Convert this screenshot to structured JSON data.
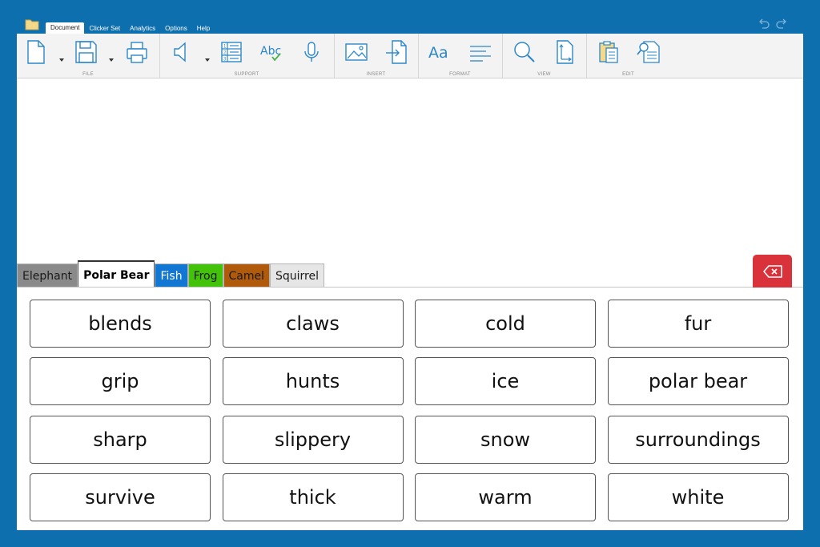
{
  "menu": {
    "tabs": [
      "Document",
      "Clicker Set",
      "Analytics",
      "Options",
      "Help"
    ],
    "active": "Document"
  },
  "ribbon": {
    "groups": [
      {
        "label": "FILE",
        "buttons": [
          "new-document",
          "save",
          "print"
        ]
      },
      {
        "label": "SUPPORT",
        "buttons": [
          "speech",
          "word-list",
          "spell-check",
          "microphone"
        ]
      },
      {
        "label": "INSERT",
        "buttons": [
          "insert-image",
          "insert-file"
        ]
      },
      {
        "label": "FORMAT",
        "buttons": [
          "font",
          "paragraph"
        ]
      },
      {
        "label": "VIEW",
        "buttons": [
          "zoom",
          "page-size"
        ]
      },
      {
        "label": "EDIT",
        "buttons": [
          "paste",
          "find"
        ]
      }
    ],
    "font_button_label": "Aa",
    "spell_button_label": "Abc"
  },
  "set_tabs": [
    {
      "label": "Elephant",
      "bg": "#8a8a8a",
      "color": "#1a1a1a"
    },
    {
      "label": "Polar Bear",
      "bg": "#ffffff",
      "color": "#000000",
      "active": true
    },
    {
      "label": "Fish",
      "bg": "#1177d3",
      "color": "#ffffff"
    },
    {
      "label": "Frog",
      "bg": "#43c20a",
      "color": "#1a1a1a"
    },
    {
      "label": "Camel",
      "bg": "#b05a0c",
      "color": "#1a1a1a"
    },
    {
      "label": "Squirrel",
      "bg": "#e6e6e6",
      "color": "#1a1a1a"
    }
  ],
  "words": [
    "blends",
    "claws",
    "cold",
    "fur",
    "grip",
    "hunts",
    "ice",
    "polar bear",
    "sharp",
    "slippery",
    "snow",
    "surroundings",
    "survive",
    "thick",
    "warm",
    "white"
  ],
  "colors": {
    "frame": "#0e6fae",
    "icon_blue": "#2b87c8",
    "delete_red": "#d9323a"
  }
}
